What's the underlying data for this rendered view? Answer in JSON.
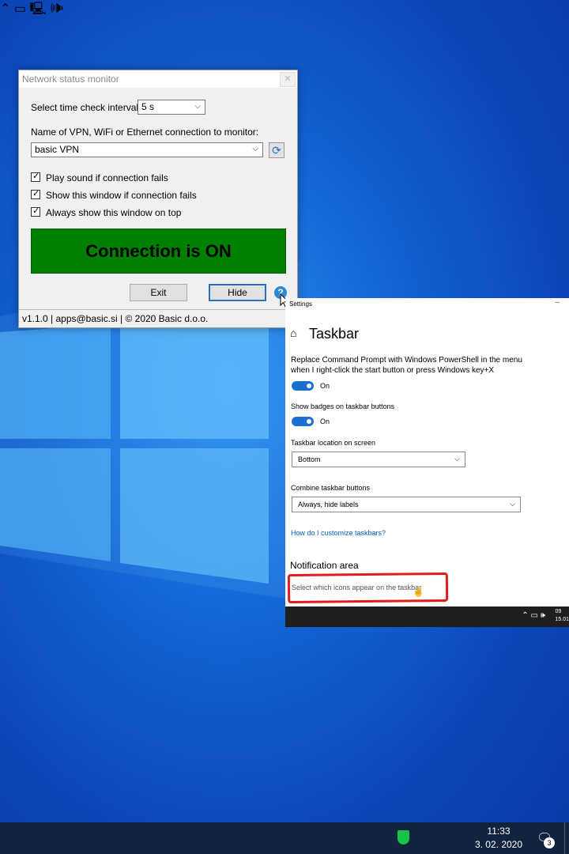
{
  "colors": {
    "connection_on": "#008000",
    "link": "#0060c0",
    "toggle_on": "#1a6fd0",
    "annotation": "#e21c1c"
  },
  "monitor": {
    "title": "Network status monitor",
    "interval_label": "Select time check interval:",
    "interval_value": "5 s",
    "connection_label": "Name of VPN, WiFi or Ethernet connection to monitor:",
    "connection_value": "basic VPN",
    "checkboxes": [
      {
        "label": "Play sound if connection fails",
        "checked": true
      },
      {
        "label": "Show this window if connection fails",
        "checked": true
      },
      {
        "label": "Always show this window on top",
        "checked": true
      }
    ],
    "status_text": "Connection is ON",
    "exit_label": "Exit",
    "hide_label": "Hide",
    "help_glyph": "?",
    "footer": "v1.1.0 | apps@basic.si | © 2020 Basic d.o.o."
  },
  "settings": {
    "title": "Settings",
    "heading": "Taskbar",
    "powershell_text_1": "Replace Command Prompt with Windows PowerShell in the menu",
    "powershell_text_2": "when I right-click the start button or press Windows key+X",
    "powershell_state": "On",
    "badges_text": "Show badges on taskbar buttons",
    "badges_state": "On",
    "location_label": "Taskbar location on screen",
    "location_value": "Bottom",
    "combine_label": "Combine taskbar buttons",
    "combine_value": "Always, hide labels",
    "customize_link": "How do I customize taskbars?",
    "notification_heading": "Notification area",
    "notification_link": "Select which icons appear on the taskbar",
    "mini_time": "09",
    "mini_date": "15.01"
  },
  "taskbar": {
    "time": "11:33",
    "date": "3. 02. 2020",
    "notification_count": "3"
  }
}
